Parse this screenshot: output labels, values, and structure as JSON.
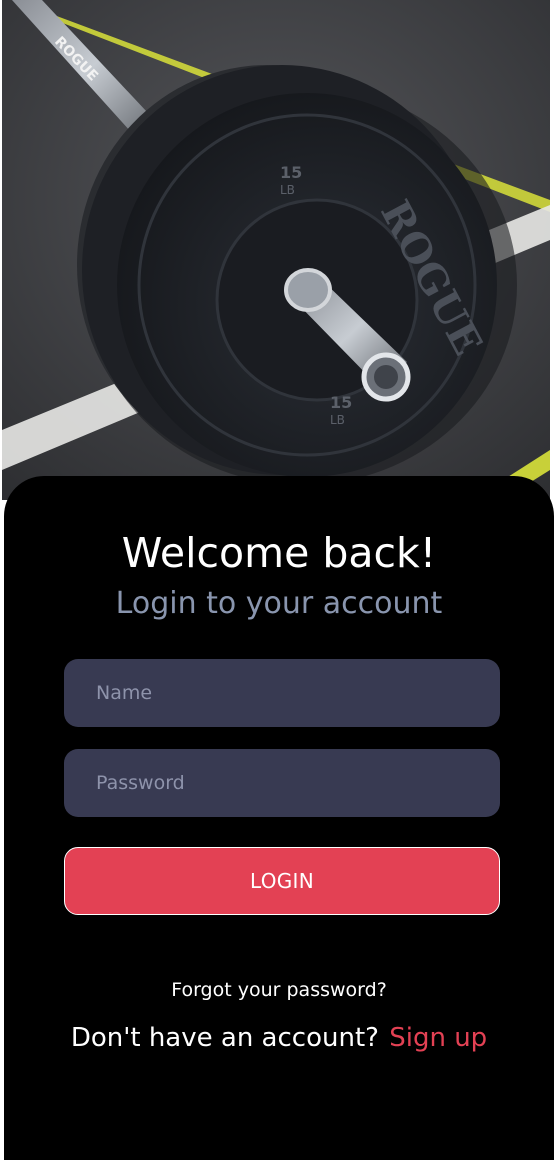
{
  "hero": {
    "image": "barbell-bumper-plate-photo",
    "plate_brand": "ROGUE",
    "plate_weight": "15",
    "plate_unit": "LB"
  },
  "login": {
    "title": "Welcome back!",
    "subtitle": "Login to your account",
    "name_placeholder": "Name",
    "password_placeholder": "Password",
    "login_label": "LOGIN",
    "forgot_label": "Forgot your password?",
    "signup_prompt": "Don't have an account?",
    "signup_label": "Sign up"
  },
  "colors": {
    "card_background": "#000000",
    "input_background": "#383a52",
    "accent": "#e34154",
    "subtitle": "#8995ae"
  }
}
